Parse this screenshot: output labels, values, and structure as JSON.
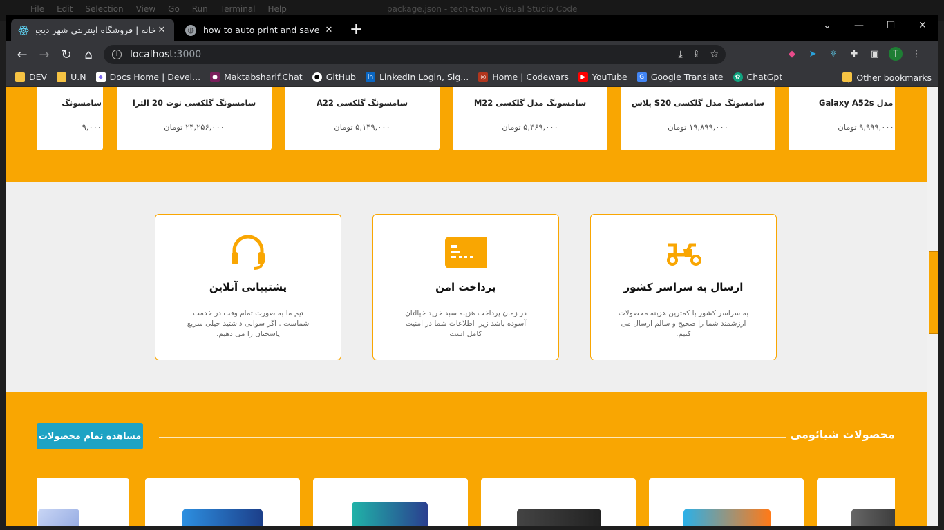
{
  "vscode": {
    "menu": [
      "File",
      "Edit",
      "Selection",
      "View",
      "Go",
      "Run",
      "Terminal",
      "Help"
    ],
    "title": "package.json - tech-town - Visual Studio Code"
  },
  "browser": {
    "tabs": [
      {
        "title": "خانه | فروشگاه اینترنتی شهر دیجیتال",
        "icon": "react-icon",
        "active": true
      },
      {
        "title": "how to auto print and save screen",
        "icon": "globe-icon",
        "active": false
      }
    ],
    "new_tab": "+",
    "window_controls": [
      "⌄",
      "—",
      "☐",
      "✕"
    ],
    "url_host": "localhost",
    "url_port": ":3000",
    "bookmarks": [
      {
        "label": "DEV",
        "icon": "folder-icon"
      },
      {
        "label": "U.N",
        "icon": "folder-icon"
      },
      {
        "label": "Docs Home | Devel...",
        "icon": "clickup-icon"
      },
      {
        "label": "Maktabsharif.Chat",
        "icon": "chat-icon"
      },
      {
        "label": "GitHub",
        "icon": "github-icon"
      },
      {
        "label": "LinkedIn Login, Sig...",
        "icon": "linkedin-icon"
      },
      {
        "label": "Home | Codewars",
        "icon": "codewars-icon"
      },
      {
        "label": "YouTube",
        "icon": "youtube-icon"
      },
      {
        "label": "Google Translate",
        "icon": "translate-icon"
      },
      {
        "label": "ChatGpt",
        "icon": "openai-icon"
      }
    ],
    "other_bookmarks": "Other bookmarks",
    "profile_initial": "T"
  },
  "samsung_row": [
    {
      "name": "سامسونگ",
      "price": "۹,۰۰۰"
    },
    {
      "name": "سامسونگ گلکسی نوت 20 الترا",
      "price": "۲۴,۲۵۶,۰۰۰ تومان"
    },
    {
      "name": "سامسونگ گلکسی A22",
      "price": "۵,۱۴۹,۰۰۰ تومان"
    },
    {
      "name": "سامسونگ مدل گلکسی M22",
      "price": "۵,۴۶۹,۰۰۰ تومان"
    },
    {
      "name": "سامسونگ مدل گلکسی S20 پلاس",
      "price": "۱۹,۸۹۹,۰۰۰ تومان"
    },
    {
      "name": "ونگ مدل Galaxy A52s",
      "price": "۹,۹۹۹,۰۰۰ تومان"
    }
  ],
  "features": [
    {
      "title": "پشتیبانی آنلاین",
      "desc": "تیم ما به صورت تمام وقت در خدمت شماست . اگر سوالی داشتید خیلی سریع پاسختان را می دهیم.",
      "icon": "headset-icon"
    },
    {
      "title": "پرداخت امن",
      "desc": "در زمان پرداخت هزینه سبد خرید خیالتان آسوده باشد زیرا اطلاعات شما در امنیت کامل است",
      "icon": "card-icon"
    },
    {
      "title": "ارسال به سراسر کشور",
      "desc": "به سراسر کشور با کمترین هزینه محصولات ارزشمند شما را صحیح و سالم ارسال می کنیم.",
      "icon": "scooter-icon"
    }
  ],
  "xiaomi": {
    "title": "محصولات شیائومی",
    "view_all": "مشاهده تمام محصولات"
  },
  "colors": {
    "accent": "#f9a602",
    "button": "#1ea3c4"
  }
}
